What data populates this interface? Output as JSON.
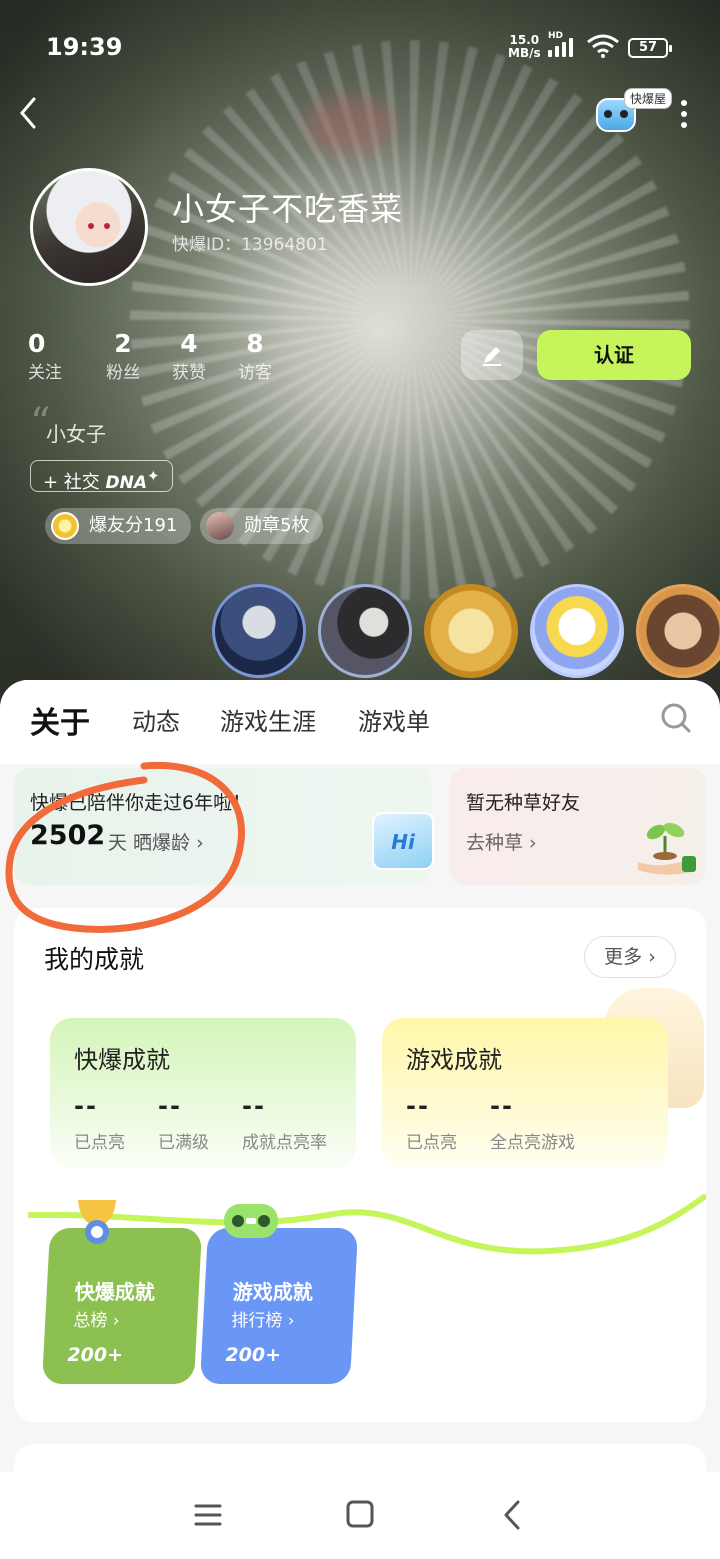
{
  "status_bar": {
    "time": "19:39",
    "net_speed": "15.0",
    "net_unit": "MB/s",
    "net_tag": "HD",
    "battery": "57"
  },
  "header": {
    "kb_house_label": "快爆屋"
  },
  "profile": {
    "username": "小女子不吃香菜",
    "user_id": "快爆ID：13964801",
    "bio": "小女子",
    "dna_prefix": "+ 社交",
    "dna_label": "DNA",
    "stats": [
      {
        "num": "0",
        "label": "关注"
      },
      {
        "num": "2",
        "label": "粉丝"
      },
      {
        "num": "4",
        "label": "获赞"
      },
      {
        "num": "8",
        "label": "访客"
      }
    ],
    "certify_label": "认证",
    "score_pill": "爆友分191",
    "medal_pill": "勋章5枚"
  },
  "tabs": [
    "关于",
    "动态",
    "游戏生涯",
    "游戏单"
  ],
  "age_card": {
    "text": "快爆已陪伴你走过6年啦！",
    "days": "2502",
    "unit": "天 晒爆龄 ›",
    "badge": "Hi"
  },
  "grass_card": {
    "title": "暂无种草好友",
    "action": "去种草 ›"
  },
  "achievements": {
    "title": "我的成就",
    "more": "更多 ›",
    "kb": {
      "title": "快爆成就",
      "items": [
        {
          "value": "--",
          "label": "已点亮"
        },
        {
          "value": "--",
          "label": "已满级"
        },
        {
          "value": "--",
          "label": "成就点亮率"
        }
      ]
    },
    "game": {
      "title": "游戏成就",
      "items": [
        {
          "value": "--",
          "label": "已点亮"
        },
        {
          "value": "--",
          "label": "全点亮游戏"
        }
      ]
    },
    "ranks": [
      {
        "title": "快爆成就",
        "sub": "总榜 ›",
        "count": "200+"
      },
      {
        "title": "游戏成就",
        "sub": "排行榜 ›",
        "count": "200+"
      }
    ]
  },
  "colors": {
    "accent": "#c6f45b",
    "rank_green": "#8cc152",
    "rank_blue": "#6a97f5",
    "annotation": "#f06a3a"
  }
}
